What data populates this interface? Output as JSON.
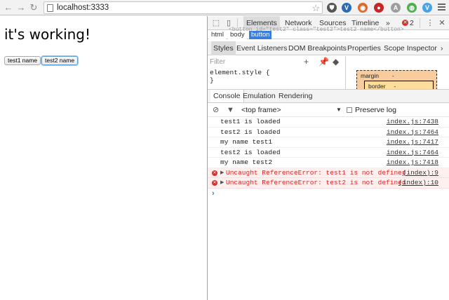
{
  "browser": {
    "url": "localhost:3333",
    "nav_icons": [
      "back-arrow-icon",
      "forward-arrow-icon",
      "reload-icon"
    ],
    "extensions": [
      {
        "name": "shield-extension-icon",
        "color": "#555555",
        "glyph": "⛊"
      },
      {
        "name": "v-extension-icon",
        "color": "#2d6ab4",
        "glyph": "V"
      },
      {
        "name": "fox-extension-icon",
        "color": "#e0692a",
        "glyph": "◉"
      },
      {
        "name": "stop-extension-icon",
        "color": "#c62828",
        "glyph": "●"
      },
      {
        "name": "a-extension-icon",
        "color": "#9e9e9e",
        "glyph": "A"
      },
      {
        "name": "globe-extension-icon",
        "color": "#4caf50",
        "glyph": "◍"
      },
      {
        "name": "v-blue-extension-icon",
        "color": "#4aa3e8",
        "glyph": "V"
      }
    ]
  },
  "page": {
    "heading": "it's working!",
    "buttons": [
      {
        "label": "test1 name"
      },
      {
        "label": "test2 name"
      }
    ]
  },
  "devtools": {
    "tabs": [
      "Elements",
      "Network",
      "Sources",
      "Timeline",
      "»"
    ],
    "selected_tab": "Elements",
    "error_count": "2",
    "shadow_text": "<button id=\"test2\" class=\"test2\">test2 name</button>",
    "breadcrumbs": [
      "html",
      "body",
      "button"
    ],
    "side_tabs": [
      "Styles",
      "Event Listeners",
      "DOM Breakpoints",
      "Properties",
      "Scope Inspector",
      "›"
    ],
    "filter_placeholder": "Filter",
    "style_rule": "element.style {\n}",
    "metrics": {
      "margin_label": "margin",
      "margin_value": "-",
      "border_label": "border",
      "border_value": "-"
    },
    "drawer_tabs": [
      "Console",
      "Emulation",
      "Rendering"
    ],
    "frame": "<top frame>",
    "preserve_log": "Preserve log",
    "messages": [
      {
        "text": "test1 is loaded",
        "source": "index.js:7438",
        "level": "log"
      },
      {
        "text": "test2 is loaded",
        "source": "index.js:7464",
        "level": "log"
      },
      {
        "text": "my name test1",
        "source": "index.js:7417",
        "level": "log"
      },
      {
        "text": "test2 is loaded",
        "source": "index.js:7464",
        "level": "log"
      },
      {
        "text": "my name test2",
        "source": "index.js:7418",
        "level": "log"
      },
      {
        "text": "Uncaught ReferenceError: test1 is not defined",
        "source": "(index):9",
        "level": "error"
      },
      {
        "text": "Uncaught ReferenceError: test2 is not defined",
        "source": "(index):10",
        "level": "error"
      }
    ],
    "colors": {
      "error": "#e02424",
      "selection": "#3b7ddc",
      "metrics_margin": "#f9cc9d",
      "metrics_border": "#fddd9b"
    }
  }
}
